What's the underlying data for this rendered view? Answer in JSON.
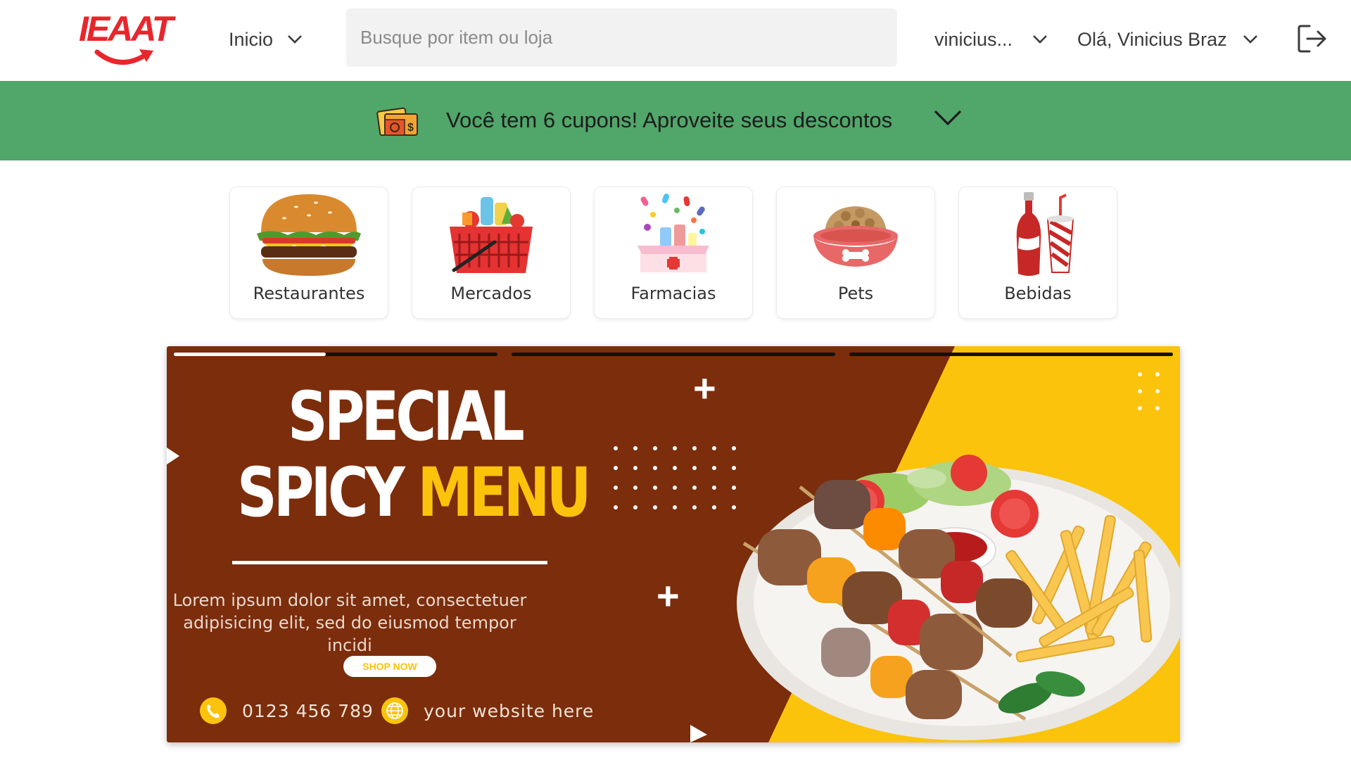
{
  "header": {
    "logo_text": "IEAAT",
    "nav_label": "Inicio",
    "search_placeholder": "Busque por item ou loja",
    "address_label": "vinicius...",
    "greeting": "Olá, Vinicius Braz"
  },
  "coupon_bar": {
    "text": "Você tem 6 cupons! Aproveite seus descontos",
    "color": "#51a66a"
  },
  "categories": [
    {
      "label": "Restaurantes",
      "icon": "burger-icon"
    },
    {
      "label": "Mercados",
      "icon": "grocery-basket-icon"
    },
    {
      "label": "Farmacias",
      "icon": "pharmacy-icon"
    },
    {
      "label": "Pets",
      "icon": "pet-bowl-icon"
    },
    {
      "label": "Bebidas",
      "icon": "drinks-icon"
    }
  ],
  "banner": {
    "headline_line1": "SPECIAL",
    "headline_line2a": "SPICY ",
    "headline_line2b": "MENU",
    "body_line1": "Lorem ipsum dolor sit amet, consectetuer",
    "body_line2": "adipisicing elit, sed do eiusmod tempor incidi",
    "cta": "SHOP NOW",
    "phone": "0123 456 789",
    "website": "your website here",
    "slide_progress": [
      0.47,
      0,
      0
    ],
    "colors": {
      "brown": "#7b2d0c",
      "yellow": "#fbc30c"
    }
  },
  "colors": {
    "brand_red": "#e8262c",
    "search_bg": "#f2f2f2"
  }
}
